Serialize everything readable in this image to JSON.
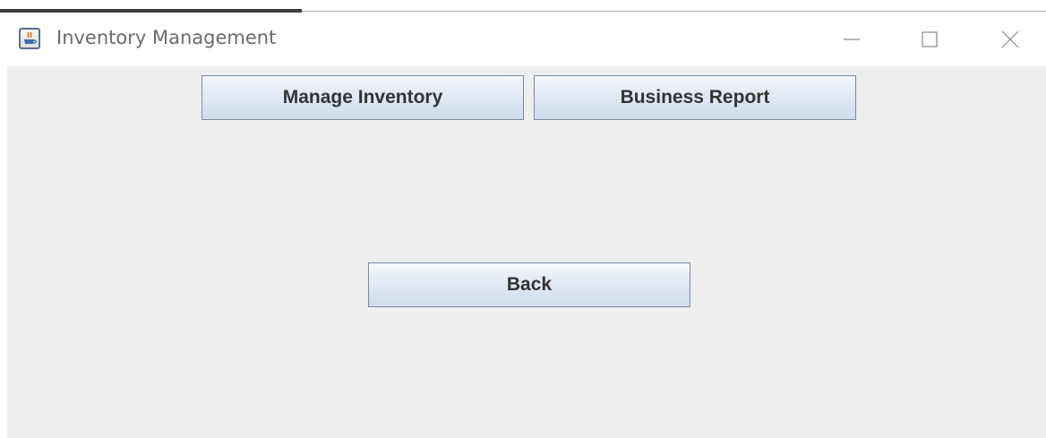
{
  "window": {
    "title": "Inventory Management",
    "icon": "java-cup-icon",
    "controls": {
      "minimize": "minimize-icon",
      "maximize": "maximize-icon",
      "close": "close-icon"
    }
  },
  "main": {
    "manage_inventory_label": "Manage Inventory",
    "business_report_label": "Business Report",
    "back_label": "Back"
  },
  "colors": {
    "content_background": "#eeeeee",
    "button_border": "#7a8aa0",
    "button_text": "#333333"
  }
}
